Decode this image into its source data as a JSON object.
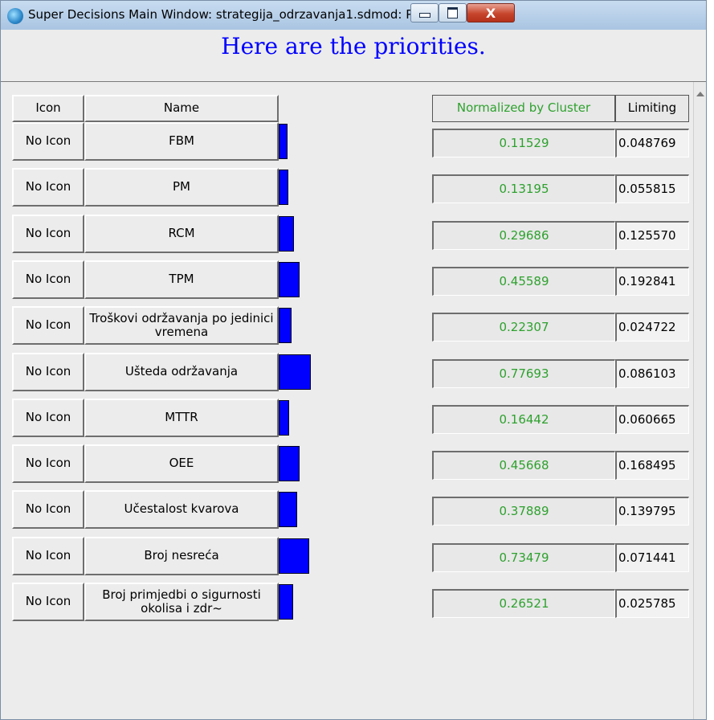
{
  "window": {
    "title": "Super Decisions Main Window: strategija_odrzavanja1.sdmod: Pr...",
    "close_glyph": "X"
  },
  "header": {
    "title": "Here are the priorities."
  },
  "table": {
    "columns": {
      "icon": "Icon",
      "name": "Name",
      "normalized": "Normalized by Cluster",
      "limiting": "Limiting"
    },
    "rows": [
      {
        "icon": "No Icon",
        "name": "FBM",
        "normalized": "0.11529",
        "limiting": "0.048769"
      },
      {
        "icon": "No Icon",
        "name": "PM",
        "normalized": "0.13195",
        "limiting": "0.055815"
      },
      {
        "icon": "No Icon",
        "name": "RCM",
        "normalized": "0.29686",
        "limiting": "0.125570"
      },
      {
        "icon": "No Icon",
        "name": "TPM",
        "normalized": "0.45589",
        "limiting": "0.192841"
      },
      {
        "icon": "No Icon",
        "name": "Troškovi održavanja po jedinici vremena",
        "normalized": "0.22307",
        "limiting": "0.024722"
      },
      {
        "icon": "No Icon",
        "name": "Ušteda održavanja",
        "normalized": "0.77693",
        "limiting": "0.086103"
      },
      {
        "icon": "No Icon",
        "name": "MTTR",
        "normalized": "0.16442",
        "limiting": "0.060665"
      },
      {
        "icon": "No Icon",
        "name": "OEE",
        "normalized": "0.45668",
        "limiting": "0.168495"
      },
      {
        "icon": "No Icon",
        "name": "Učestalost kvarova",
        "normalized": "0.37889",
        "limiting": "0.139795"
      },
      {
        "icon": "No Icon",
        "name": "Broj nesreća",
        "normalized": "0.73479",
        "limiting": "0.071441"
      },
      {
        "icon": "No Icon",
        "name": "Broj primjedbi o sigurnosti okolisa i zdr~",
        "normalized": "0.26521",
        "limiting": "0.025785"
      }
    ]
  },
  "colors": {
    "title_blue": "#0000ff",
    "bar_blue": "#0000ff",
    "value_green": "#2ea12e"
  },
  "icons": {
    "app": "super-decisions-app-icon",
    "minimize": "minimize-icon",
    "maximize": "maximize-icon",
    "close": "close-icon",
    "scroll_up": "scroll-up-arrow-icon"
  }
}
